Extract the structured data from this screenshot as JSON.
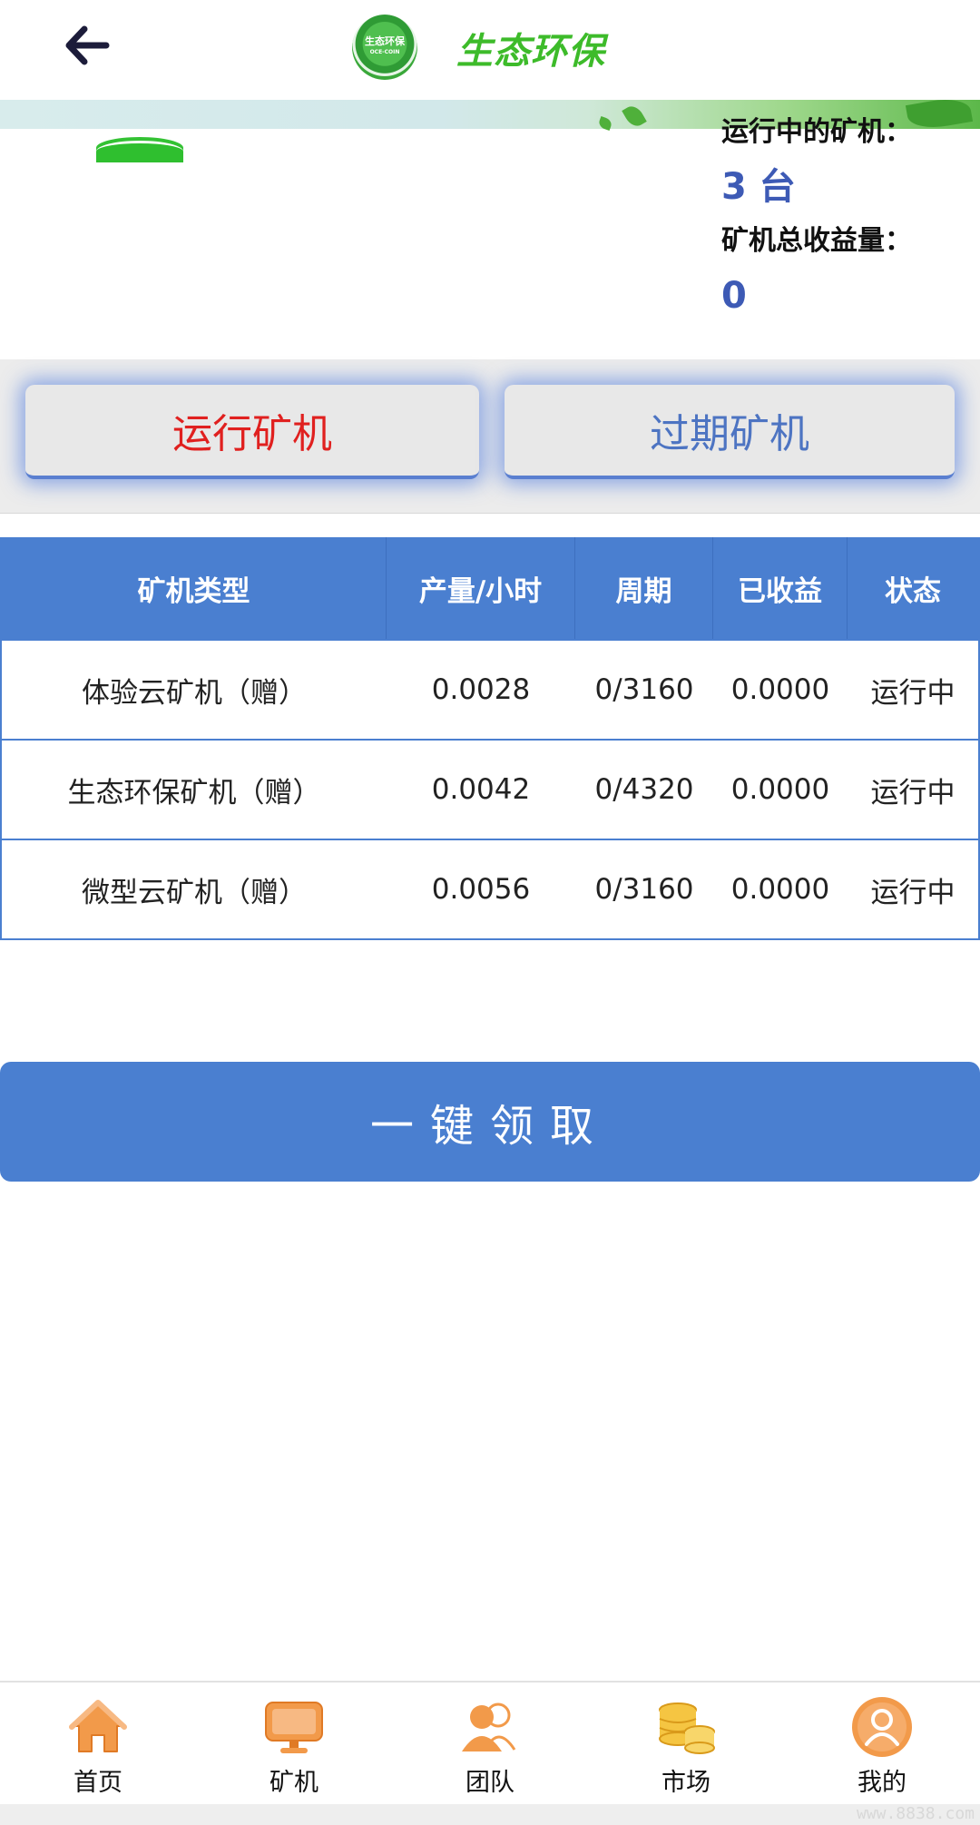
{
  "header": {
    "title": "生态环保",
    "logo_text": "生态环保",
    "logo_subtext": "OCE-COIN"
  },
  "stats": {
    "running_label": "运行中的矿机：",
    "running_value": "3 台",
    "total_label": "矿机总收益量：",
    "total_value": "0"
  },
  "tabs": {
    "running": "运行矿机",
    "expired": "过期矿机"
  },
  "table": {
    "headers": [
      "矿机类型",
      "产量/小时",
      "周期",
      "已收益",
      "状态"
    ],
    "rows": [
      [
        "体验云矿机（赠）",
        "0.0028",
        "0/3160",
        "0.0000",
        "运行中"
      ],
      [
        "生态环保矿机（赠）",
        "0.0042",
        "0/4320",
        "0.0000",
        "运行中"
      ],
      [
        "微型云矿机（赠）",
        "0.0056",
        "0/3160",
        "0.0000",
        "运行中"
      ]
    ]
  },
  "claim_button": "一键领取",
  "nav": [
    {
      "label": "首页",
      "icon": "home-icon"
    },
    {
      "label": "矿机",
      "icon": "miner-icon"
    },
    {
      "label": "团队",
      "icon": "team-icon"
    },
    {
      "label": "市场",
      "icon": "market-icon"
    },
    {
      "label": "我的",
      "icon": "profile-icon"
    }
  ],
  "watermark": "www.8838.com",
  "colors": {
    "accent_blue": "#4a7fd0",
    "running_red": "#e0201f",
    "title_green": "#3dbb2a",
    "stat_blue": "#3d5ab5",
    "nav_orange": "#f29a4a"
  }
}
